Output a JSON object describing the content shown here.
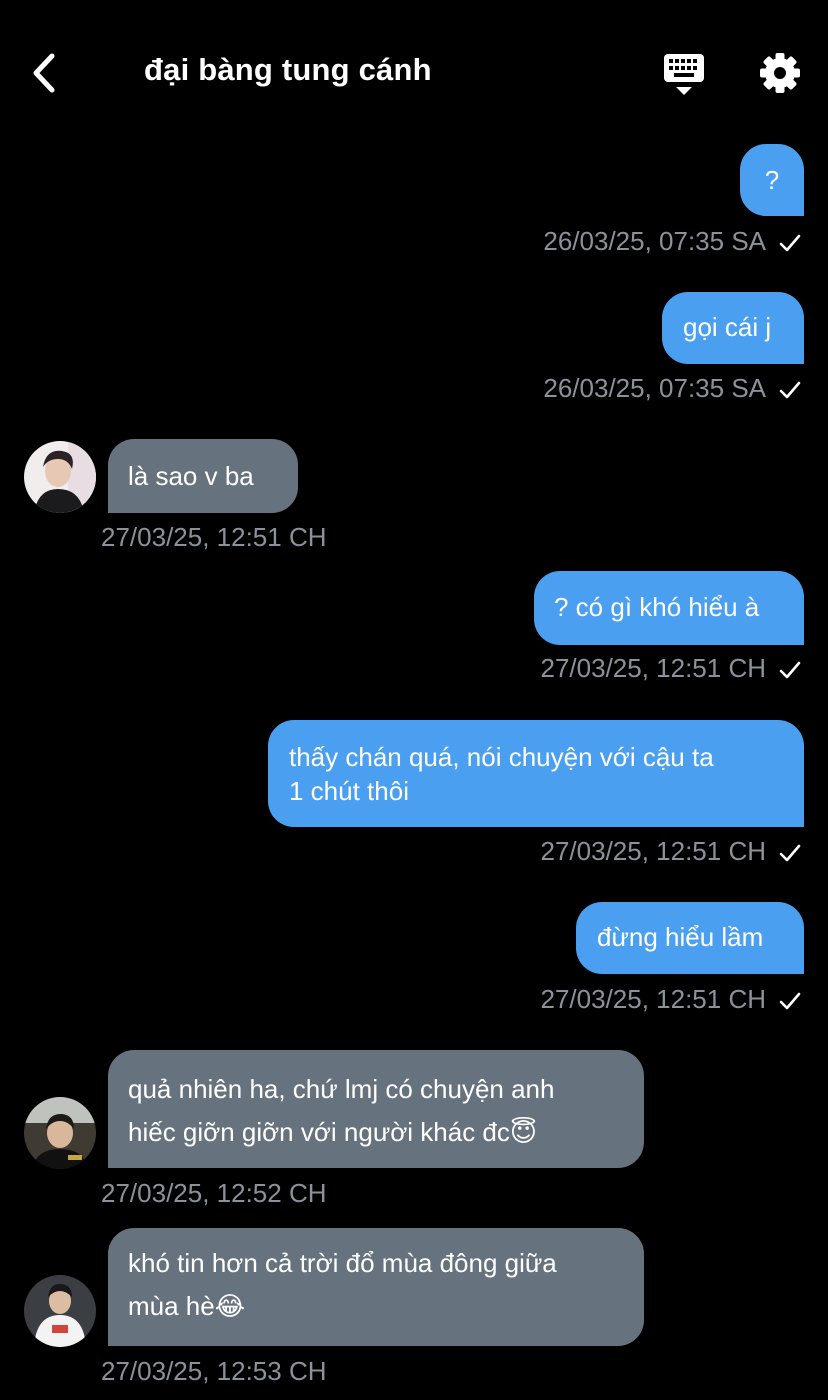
{
  "header": {
    "title": "đại bàng tung cánh",
    "back_icon": "chevron-left-icon",
    "keyboard_icon": "keyboard-hide-icon",
    "settings_icon": "gear-icon"
  },
  "colors": {
    "background": "#000000",
    "outgoing_bubble": "#4a9ff0",
    "incoming_bubble": "#67727f",
    "timestamp": "#8a929c"
  },
  "messages": [
    {
      "direction": "outgoing",
      "text": "?",
      "time": "26/03/25, 07:35 SA",
      "status": "sent"
    },
    {
      "direction": "outgoing",
      "text": "gọi cái j",
      "time": "26/03/25, 07:35 SA",
      "status": "sent"
    },
    {
      "direction": "incoming",
      "text": "là sao v ba",
      "time": "27/03/25, 12:51 CH"
    },
    {
      "direction": "outgoing",
      "text": "? có gì khó hiểu à",
      "time": "27/03/25, 12:51 CH",
      "status": "sent"
    },
    {
      "direction": "outgoing",
      "text": "thấy chán quá, nói chuyện với cậu ta\n1 chút thôi",
      "time": "27/03/25, 12:51 CH",
      "status": "sent"
    },
    {
      "direction": "outgoing",
      "text": "đừng hiểu lầm",
      "time": "27/03/25, 12:51 CH",
      "status": "sent"
    },
    {
      "direction": "incoming",
      "text": "quả nhiên ha, chứ lmj có chuyện anh\nhiếc giỡn giỡn với người khác đc😇",
      "time": "27/03/25, 12:52 CH"
    },
    {
      "direction": "incoming",
      "text": "khó tin hơn cả trời đổ mùa đông giữa\nmùa hè😂",
      "time": "27/03/25, 12:53 CH"
    }
  ]
}
